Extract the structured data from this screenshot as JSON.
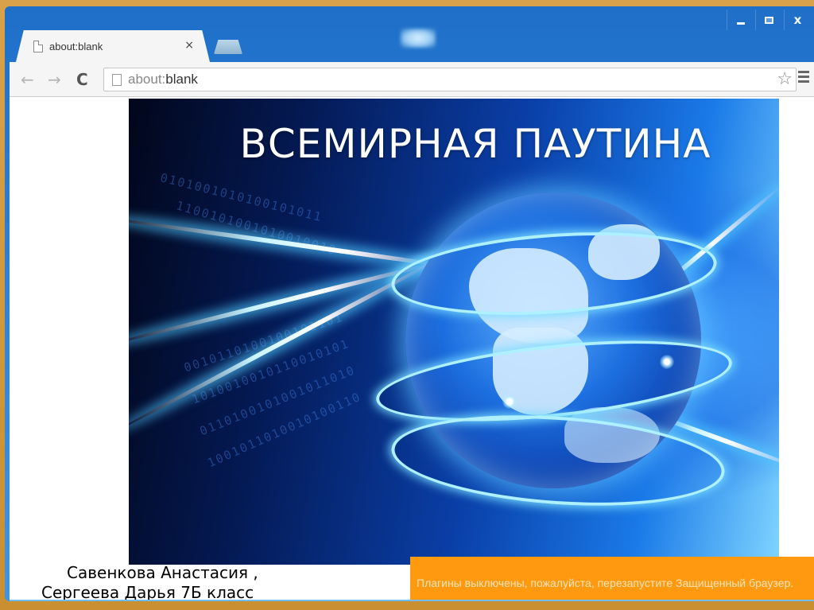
{
  "browser": {
    "tab": {
      "title": "about:blank",
      "close_glyph": "×",
      "page_icon": "page-icon"
    },
    "window_controls": {
      "minimize": "minimize-icon",
      "maximize": "maximize-icon",
      "close": "x"
    },
    "toolbar": {
      "back_glyph": "←",
      "forward_glyph": "→",
      "reload_glyph": "C",
      "address_prefix": "about:",
      "address_host": "blank",
      "star_glyph": "☆"
    }
  },
  "slide": {
    "title": "ВСЕМИРНАЯ ПАУТИНА",
    "authors": {
      "line1": "Савенкова Анастасия ,",
      "line2": "Сергеева Дарья 7Б класс"
    },
    "binary_rows": [
      "0101001010100101011",
      "1100101001010010010",
      "0010110100100101101",
      "1010010010110010101",
      "0110100101001011010",
      "1001011010010100110"
    ]
  },
  "notification": {
    "text": "Плагины выключены, пожалуйста, перезапустите Защищенный браузер.",
    "color": "#ff9a10"
  },
  "colors": {
    "frame": "#d49a3a",
    "titlebar": "#2a80d6",
    "hero_dark": "#041a55",
    "hero_light": "#7fd4ff"
  }
}
